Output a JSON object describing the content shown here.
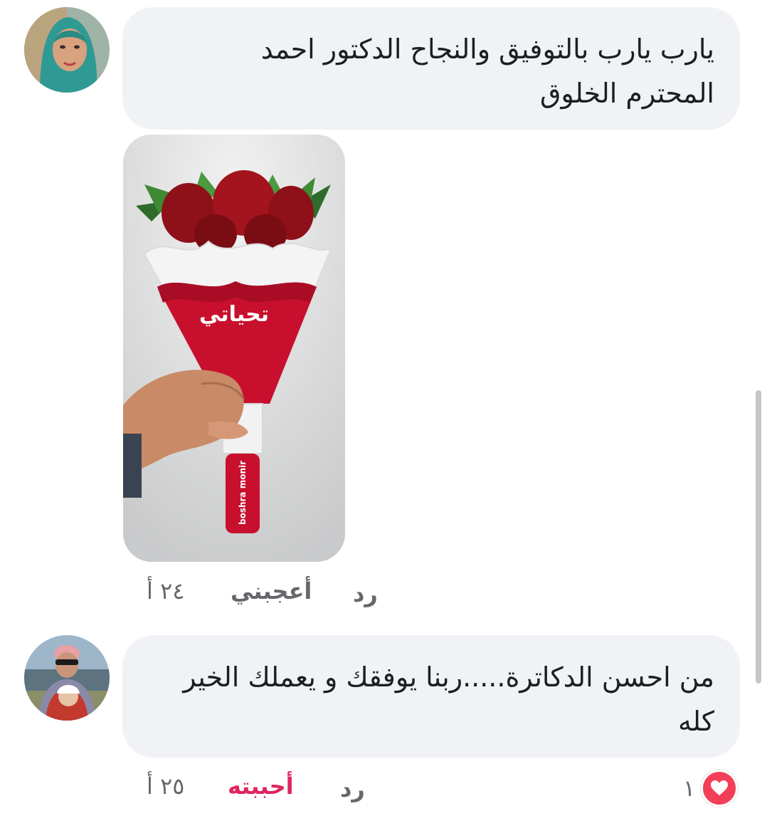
{
  "comments": [
    {
      "text_line1": "يارب يارب بالتوفيق والنجاح الدكتور احمد",
      "text_line2": "المحترم الخلوق",
      "image_caption": "تحياتي",
      "image_watermark": "boshra monir",
      "time": "٢٤ أ",
      "like_label": "أعجبني",
      "reply_label": "رد"
    },
    {
      "text_line1": "من احسن الدكاترة.....ربنا يوفقك و يعملك الخير",
      "text_line2": "كله",
      "time": "٢٥ أ",
      "like_label": "أحببته",
      "reply_label": "رد",
      "reaction_count": "١",
      "reaction_icon": "heart-icon"
    }
  ],
  "colors": {
    "bubble": "#f0f2f5",
    "meta_text": "#65676b",
    "love_reaction": "#e0245e",
    "heart_badge": "#f33e58"
  }
}
